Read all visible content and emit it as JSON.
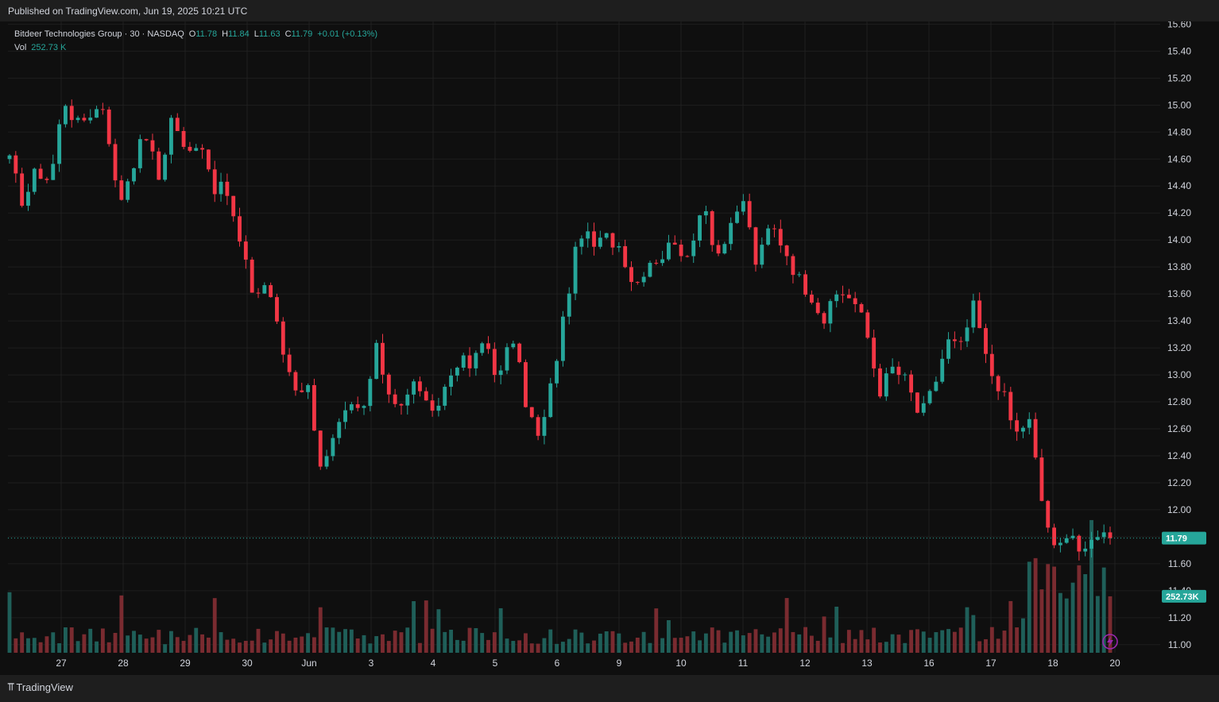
{
  "header": {
    "published": "Published on TradingView.com, Jun 19, 2025 10:21 UTC"
  },
  "footer": {
    "brand": "TradingView"
  },
  "legend": {
    "symbol": "Bitdeer Technologies Group · 30 · NASDAQ",
    "o_label": "O",
    "o": "11.78",
    "h_label": "H",
    "h": "11.84",
    "l_label": "L",
    "l": "11.63",
    "c_label": "C",
    "c": "11.79",
    "change": "+0.01 (+0.13%)",
    "vol_label": "Vol",
    "vol": "252.73 K"
  },
  "colors": {
    "up": "#26a69a",
    "down": "#f23645",
    "vol_up": "#1f5f59",
    "vol_down": "#7a2b30",
    "bg": "#0f0f0f"
  },
  "chart_data": {
    "type": "candlestick",
    "interval": "30",
    "yaxis_ticks": [
      11.0,
      11.2,
      11.4,
      11.6,
      11.8,
      12.0,
      12.2,
      12.4,
      12.6,
      12.8,
      13.0,
      13.2,
      13.4,
      13.6,
      13.8,
      14.0,
      14.2,
      14.4,
      14.6,
      14.8,
      15.0,
      15.2,
      15.4,
      15.6
    ],
    "ylim": [
      10.94,
      15.62
    ],
    "x_ticks": [
      "27",
      "28",
      "29",
      "30",
      "Jun",
      "3",
      "4",
      "5",
      "6",
      "9",
      "10",
      "11",
      "12",
      "13",
      "16",
      "17",
      "18",
      "20"
    ],
    "last_price": "11.79",
    "last_volume": "252.73K",
    "volume_max": 640,
    "anchors": [
      {
        "date": "26",
        "price": 14.58
      },
      {
        "date": "26",
        "price": 14.28
      },
      {
        "date": "27",
        "price": 14.52
      },
      {
        "date": "27",
        "price": 14.44
      },
      {
        "date": "27",
        "price": 15.05
      },
      {
        "date": "27",
        "price": 14.85
      },
      {
        "date": "28",
        "price": 14.95
      },
      {
        "date": "28",
        "price": 15.0
      },
      {
        "date": "28",
        "price": 14.25
      },
      {
        "date": "28",
        "price": 14.55
      },
      {
        "date": "29",
        "price": 14.8
      },
      {
        "date": "29",
        "price": 14.45
      },
      {
        "date": "29",
        "price": 14.95
      },
      {
        "date": "29",
        "price": 14.6
      },
      {
        "date": "29",
        "price": 14.78
      },
      {
        "date": "30",
        "price": 14.4
      },
      {
        "date": "30",
        "price": 14.35
      },
      {
        "date": "30",
        "price": 13.95
      },
      {
        "date": "30",
        "price": 13.58
      },
      {
        "date": "30",
        "price": 13.7
      },
      {
        "date": "30",
        "price": 13.2
      },
      {
        "date": "Jun",
        "price": 12.92
      },
      {
        "date": "Jun",
        "price": 12.9
      },
      {
        "date": "Jun",
        "price": 12.28
      },
      {
        "date": "Jun",
        "price": 12.55
      },
      {
        "date": "Jun",
        "price": 12.75
      },
      {
        "date": "3",
        "price": 12.72
      },
      {
        "date": "3",
        "price": 13.18
      },
      {
        "date": "3",
        "price": 12.85
      },
      {
        "date": "3",
        "price": 12.78
      },
      {
        "date": "4",
        "price": 12.98
      },
      {
        "date": "4",
        "price": 12.65
      },
      {
        "date": "4",
        "price": 12.9
      },
      {
        "date": "4",
        "price": 13.12
      },
      {
        "date": "5",
        "price": 13.05
      },
      {
        "date": "5",
        "price": 13.28
      },
      {
        "date": "5",
        "price": 12.95
      },
      {
        "date": "5",
        "price": 13.3
      },
      {
        "date": "5",
        "price": 12.8
      },
      {
        "date": "6",
        "price": 12.5
      },
      {
        "date": "6",
        "price": 12.99
      },
      {
        "date": "6",
        "price": 13.55
      },
      {
        "date": "6",
        "price": 14.08
      },
      {
        "date": "6",
        "price": 13.95
      },
      {
        "date": "9",
        "price": 14.02
      },
      {
        "date": "9",
        "price": 13.95
      },
      {
        "date": "9",
        "price": 13.65
      },
      {
        "date": "9",
        "price": 13.85
      },
      {
        "date": "10",
        "price": 13.88
      },
      {
        "date": "10",
        "price": 14.02
      },
      {
        "date": "10",
        "price": 13.8
      },
      {
        "date": "10",
        "price": 14.35
      },
      {
        "date": "10",
        "price": 13.88
      },
      {
        "date": "11",
        "price": 14.05
      },
      {
        "date": "11",
        "price": 14.3
      },
      {
        "date": "11",
        "price": 13.8
      },
      {
        "date": "11",
        "price": 14.12
      },
      {
        "date": "11",
        "price": 13.95
      },
      {
        "date": "12",
        "price": 13.72
      },
      {
        "date": "12",
        "price": 13.6
      },
      {
        "date": "12",
        "price": 13.4
      },
      {
        "date": "12",
        "price": 13.62
      },
      {
        "date": "13",
        "price": 13.58
      },
      {
        "date": "13",
        "price": 13.35
      },
      {
        "date": "13",
        "price": 12.88
      },
      {
        "date": "13",
        "price": 13.05
      },
      {
        "date": "16",
        "price": 12.95
      },
      {
        "date": "16",
        "price": 12.68
      },
      {
        "date": "16",
        "price": 12.9
      },
      {
        "date": "16",
        "price": 13.25
      },
      {
        "date": "17",
        "price": 13.2
      },
      {
        "date": "17",
        "price": 13.52
      },
      {
        "date": "17",
        "price": 13.05
      },
      {
        "date": "17",
        "price": 12.9
      },
      {
        "date": "17",
        "price": 12.55
      },
      {
        "date": "18",
        "price": 12.68
      },
      {
        "date": "18",
        "price": 12.05
      },
      {
        "date": "18",
        "price": 11.65
      },
      {
        "date": "18",
        "price": 11.9
      },
      {
        "date": "18",
        "price": 11.62
      },
      {
        "date": "20",
        "price": 11.85
      },
      {
        "date": "20",
        "price": 11.79
      }
    ]
  }
}
